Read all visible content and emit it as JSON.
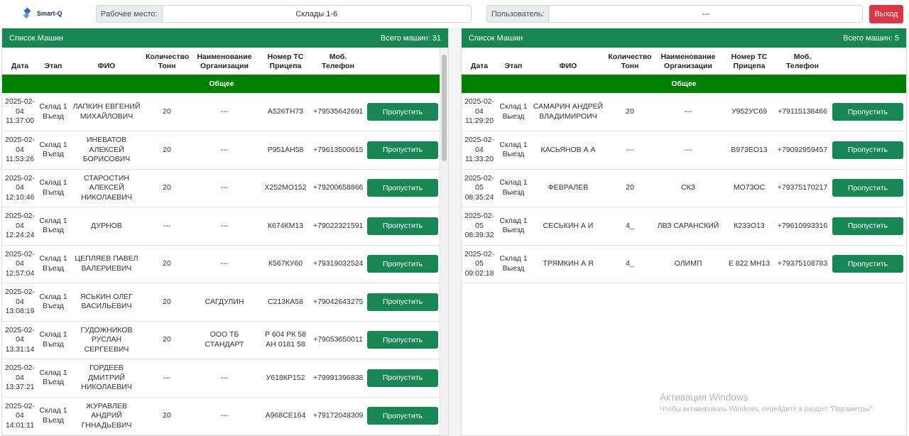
{
  "header": {
    "logo_text": "Smart-Q",
    "workplace_label": "Рабочее место:",
    "workplace_value": "Склады 1-6",
    "user_label": "Пользователь:",
    "user_value": "---",
    "logout_label": "Выход"
  },
  "columns": [
    "Дата",
    "Этап",
    "ФИО",
    "Количество Тонн",
    "Наименование Организации",
    "Номер ТС Прицепа",
    "Моб. Телефон"
  ],
  "left": {
    "title": "Список Машин",
    "total": "Всего машин: 31",
    "group": "Общее",
    "rows": [
      {
        "date": "2025-02-04 11:37:00",
        "stage": "Склад 1 Въезд",
        "name": "ЛАПКИН ЕВГЕНИЙ МИХАЙЛОВИЧ",
        "tons": "20",
        "org": "---",
        "plate": "А526ТН73",
        "phone": "+79535642691",
        "action": "Пропустить"
      },
      {
        "date": "2025-02-04 11:53:26",
        "stage": "Склад 1 Въезд",
        "name": "ИНЕВАТОВ АЛЕКСЕЙ БОРИСОВИЧ",
        "tons": "20",
        "org": "---",
        "plate": "Р951АН58",
        "phone": "+79613500615",
        "action": "Пропустить"
      },
      {
        "date": "2025-02-04 12:10:46",
        "stage": "Склад 1 Въезд",
        "name": "СТАРОСТИН АЛЕКСЕЙ НИКОЛАЕВИЧ",
        "tons": "20",
        "org": "---",
        "plate": "Х252МО152",
        "phone": "+79200658866",
        "action": "Пропустить"
      },
      {
        "date": "2025-02-04 12:24:24",
        "stage": "Склад 1 Въезд",
        "name": "ДУРНОВ",
        "tons": "---",
        "org": "---",
        "plate": "К674КМ13",
        "phone": "+79022321591",
        "action": "Пропустить"
      },
      {
        "date": "2025-02-04 12:57:04",
        "stage": "Склад 1 Въезд",
        "name": "ЦЕПЛЯЕВ ПАВЕЛ ВАЛЕРИЕВИЧ",
        "tons": "20",
        "org": "---",
        "plate": "К567КУ60",
        "phone": "+79319032524",
        "action": "Пропустить"
      },
      {
        "date": "2025-02-04 13:08:19",
        "stage": "Склад 1 Въезд",
        "name": "ЯСЬКИН ОЛЕГ ВАСИЛЬЕВИЧ",
        "tons": "20",
        "org": "САГДУЛИН",
        "plate": "С213КА58",
        "phone": "+79042643275",
        "action": "Пропустить"
      },
      {
        "date": "2025-02-04 13:31:14",
        "stage": "Склад 1 Въезд",
        "name": "ГУДОЖНИКОВ РУСЛАН СЕРГЕЕВИЧ",
        "tons": "20",
        "org": "ООО ТБ СТАНДАРТ",
        "plate": "Р 604 РК 58 АН 0181 58",
        "phone": "+79053650011",
        "action": "Пропустить"
      },
      {
        "date": "2025-02-04 13:37:21",
        "stage": "Склад 1 Въезд",
        "name": "ГОРДЕЕВ ДМИТРИЙ НИКОЛАЕВИЧ",
        "tons": "---",
        "org": "---",
        "plate": "У618КР152",
        "phone": "+79991396838",
        "action": "Пропустить"
      },
      {
        "date": "2025-02-04 14:01:11",
        "stage": "Склад 1 Въезд",
        "name": "ЖУРАВЛЕВ АНДРИЙ ГННАДЬЕВИЧ",
        "tons": "20",
        "org": "---",
        "plate": "А968СЕ164",
        "phone": "+79172048309",
        "action": "Пропустить"
      }
    ]
  },
  "right": {
    "title": "Список Машин",
    "total": "Всего машин: 5",
    "group": "Общее",
    "rows": [
      {
        "date": "2025-02-04 11:29:20",
        "stage": "Склад 1 Выезд",
        "name": "САМАРИН АНДРЕЙ ВЛАДИМИРОИЧ",
        "tons": "20",
        "org": "---",
        "plate": "У952УС69",
        "phone": "+79115138466",
        "action": "Пропустить"
      },
      {
        "date": "2025-02-04 11:33:20",
        "stage": "Склад 1 Выезд",
        "name": "КАСЬЯНОВ А А",
        "tons": "---",
        "org": "---",
        "plate": "В973ЕО13",
        "phone": "+79092959457",
        "action": "Пропустить"
      },
      {
        "date": "2025-02-05 08:35:24",
        "stage": "Склад 1 Выезд",
        "name": "ФЕВРАЛЕВ",
        "tons": "20",
        "org": "СКЗ",
        "plate": "МО73ОС",
        "phone": "+79375170217",
        "action": "Пропустить"
      },
      {
        "date": "2025-02-05 08:39:32",
        "stage": "Склад 1 Выезд",
        "name": "СЕСЬКИН А И",
        "tons": "4_",
        "org": "ЛВЗ САРАНСКИЙ",
        "plate": "К233О13",
        "phone": "+79610993316",
        "action": "Пропустить"
      },
      {
        "date": "2025-02-05 09:02:18",
        "stage": "Склад 1 Выезд",
        "name": "ТРЯМКИН А Я",
        "tons": "4_",
        "org": "ОЛИМП",
        "plate": "Е 822 МН13",
        "phone": "+79375108783",
        "action": "Пропустить"
      }
    ]
  },
  "watermark": {
    "title": "Активация Windows",
    "subtitle": "Чтобы активировать Windows, перейдите в раздел \"Параметры\"."
  }
}
